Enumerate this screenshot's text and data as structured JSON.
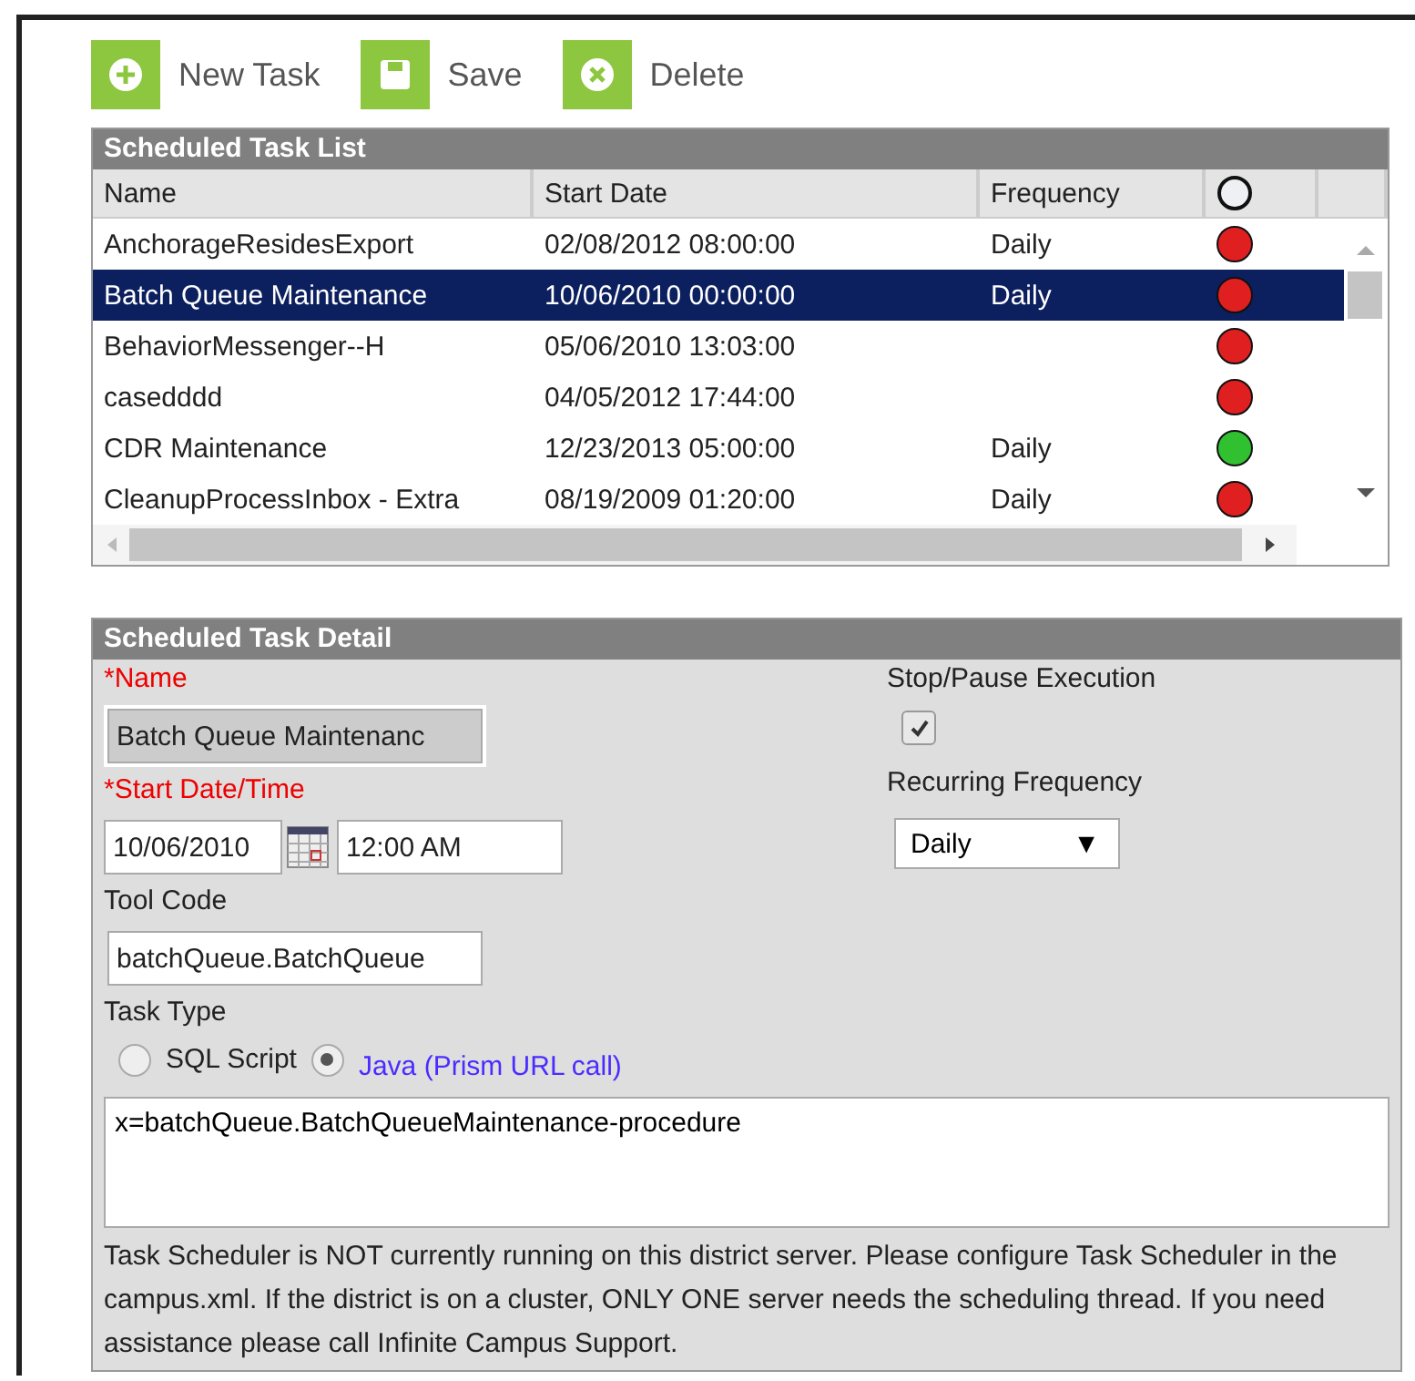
{
  "toolbar": [
    {
      "kind": "new",
      "label": "New Task"
    },
    {
      "kind": "save",
      "label": "Save"
    },
    {
      "kind": "delete",
      "label": "Delete"
    }
  ],
  "task_list": {
    "title": "Scheduled Task List",
    "columns": [
      "Name",
      "Start Date",
      "Frequency"
    ],
    "rows": [
      {
        "name": "AnchorageResidesExport",
        "start_date": "02/08/2012 08:00:00",
        "frequency": "Daily",
        "color": "#e02020",
        "selected": false
      },
      {
        "name": "Batch Queue Maintenance",
        "start_date": "10/06/2010 00:00:00",
        "frequency": "Daily",
        "color": "#e02020",
        "selected": true
      },
      {
        "name": "BehaviorMessenger--H",
        "start_date": "05/06/2010 13:03:00",
        "color": "#e02020",
        "selected": false
      },
      {
        "name": "casedddd",
        "start_date": "04/05/2012 17:44:00",
        "color": "#e02020",
        "selected": false
      },
      {
        "name": "CDR Maintenance",
        "start_date": "12/23/2013 05:00:00",
        "frequency": "Daily",
        "color": "#30c030",
        "selected": false
      },
      {
        "name": "CleanupProcessInbox - Extra",
        "start_date": "08/19/2009 01:20:00",
        "frequency": "Daily",
        "color": "#e02020",
        "selected": false
      }
    ]
  },
  "detail": {
    "title": "Scheduled Task Detail",
    "name_label": "*Name",
    "name_value": "Batch Queue Maintenanc",
    "start_label": "*Start Date/Time",
    "date_value": "10/06/2010",
    "time_value": "12:00 AM",
    "tool_code_label": "Tool Code",
    "tool_code_value": "batchQueue.BatchQueue",
    "stop_label": "Stop/Pause Execution",
    "stop_checked": true,
    "recurring_label": "Recurring Frequency",
    "recurring_value": "Daily",
    "recurring_caret": "▼",
    "task_type_label": "Task Type",
    "task_types": [
      {
        "label": "SQL Script",
        "selected": false
      },
      {
        "label": "Java (Prism URL call)",
        "selected": true
      }
    ],
    "command": "x=batchQueue.BatchQueueMaintenance-procedure",
    "notice": "Task Scheduler is NOT currently running on this district server. Please configure Task Scheduler in the campus.xml. If the district is on a cluster, ONLY ONE server needs the scheduling thread. If you need assistance please call Infinite Campus Support."
  }
}
